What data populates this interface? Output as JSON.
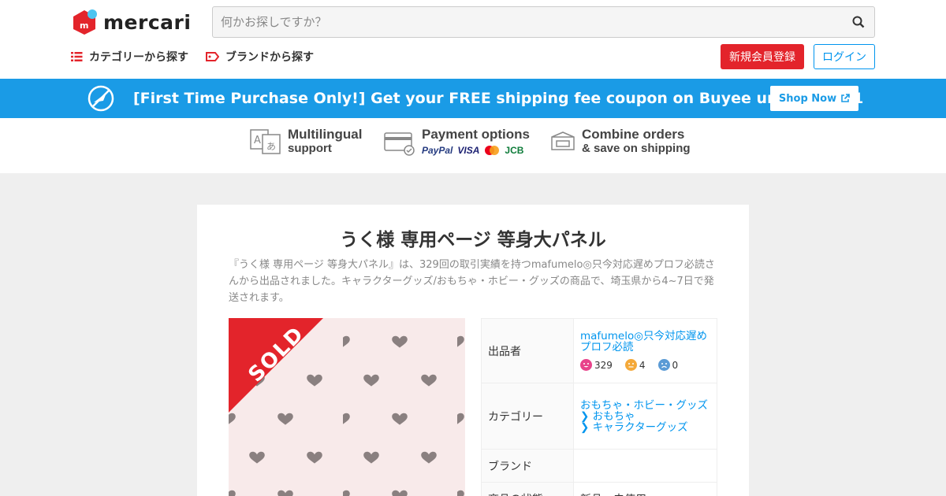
{
  "header": {
    "logo_text": "mercari",
    "search_placeholder": "何かお探しですか？",
    "nav_category": "カテゴリーから探す",
    "nav_brand": "ブランドから探す",
    "signup": "新規会員登録",
    "login": "ログイン"
  },
  "banner": {
    "text": "[First Time Purchase Only!] Get your FREE shipping fee coupon on Buyee until June 21",
    "shop_now": "Shop Now"
  },
  "features": [
    {
      "title": "Multilingual",
      "sub": "support",
      "icon": "translate-icon"
    },
    {
      "title": "Payment options",
      "sub": "",
      "icon": "card-check-icon",
      "logos": [
        "PayPal",
        "VISA",
        "JCB"
      ]
    },
    {
      "title": "Combine orders",
      "sub": "& save on shipping",
      "icon": "box-icon"
    }
  ],
  "product": {
    "title": "うく様 専用ページ 等身大パネル",
    "description": "『うく様 専用ページ 等身大パネル』は、329回の取引実績を持つmafumelo◎只今対応遅めプロフ必読さんから出品されました。キャラクターグッズ/おもちゃ・ホビー・グッズの商品で、埼玉県から4~7日で発送されます。",
    "sold_label": "SOLD",
    "info": {
      "seller_label": "出品者",
      "seller_name": "mafumelo◎只今対応遅めプロフ必読",
      "ratings": {
        "good": "329",
        "normal": "4",
        "bad": "0"
      },
      "category_label": "カテゴリー",
      "category_1": "おもちゃ・ホビー・グッズ",
      "category_2": "おもちゃ",
      "category_3": "キャラクターグッズ",
      "brand_label": "ブランド",
      "brand_value": "",
      "condition_label": "商品の状態",
      "condition_value": "新品、未使用"
    }
  },
  "colors": {
    "brand_red": "#e3242b",
    "accent_blue": "#0095ee",
    "banner_blue": "#1a9be6"
  }
}
